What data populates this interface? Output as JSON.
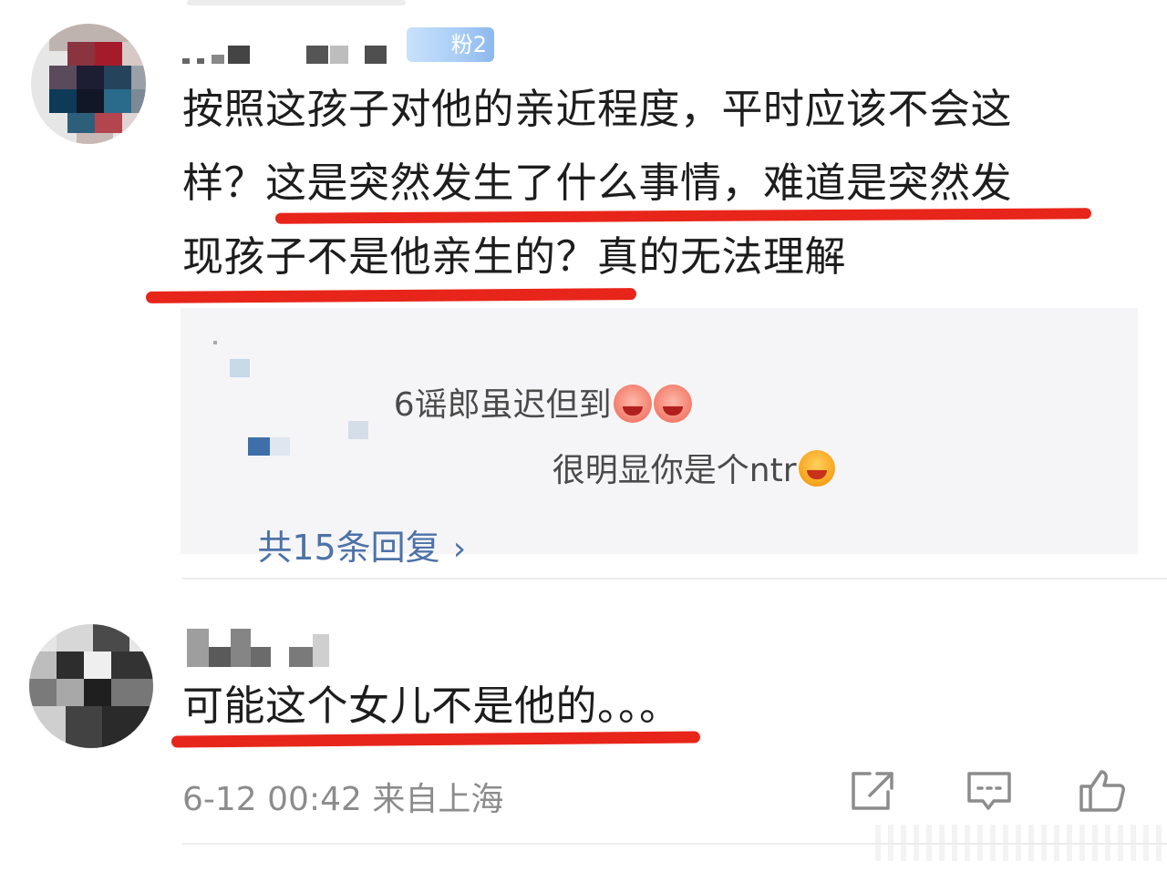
{
  "colors": {
    "underline_red": "#e8251a",
    "link_blue": "#4d72a8",
    "reply_bg": "#f5f5f7",
    "meta_gray": "#8c8c8c"
  },
  "comment1": {
    "badge": "粉2",
    "lines": [
      "按照这孩子对他的亲近程度，平时应该不会这",
      "样？这是突然发生了什么事情，难道是突然发",
      "现孩子不是他亲生的？真的无法理解"
    ],
    "replies": {
      "items": [
        {
          "text": "6谣郎虽迟但到",
          "emojis": [
            "pig-laugh-emoji",
            "pig-laugh-emoji"
          ]
        },
        {
          "text": "很明显你是个ntr",
          "emojis": [
            "laughing-face-emoji"
          ]
        }
      ],
      "more_label": "共15条回复",
      "more_icon": "chevron-right-icon"
    }
  },
  "comment2": {
    "text": "可能这个女儿不是他的。。。",
    "meta": "6-12 00:42 来自上海",
    "actions": [
      "share-icon",
      "comment-icon",
      "like-icon"
    ]
  }
}
